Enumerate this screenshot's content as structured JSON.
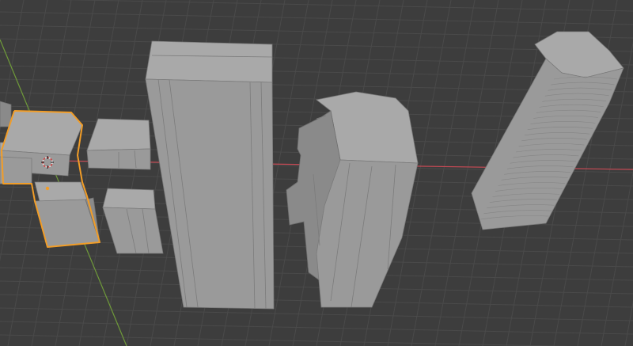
{
  "viewport": {
    "name": "3D Viewport",
    "background_color": "#3d3d3d",
    "grid_color": "#4a4a4a",
    "x_axis_color": "#c84a55",
    "y_axis_color": "#6f9a3a",
    "selection_outline_color": "#f29d27",
    "mesh_face_color": "#9a9a9a",
    "mesh_top_color": "#a9a9a9",
    "mesh_dark_color": "#8a8a8a"
  },
  "scene": {
    "objects": [
      {
        "name": "building-partial-left",
        "selected": false
      },
      {
        "name": "building-l-shaped",
        "selected": true
      },
      {
        "name": "building-small-twin",
        "selected": false
      },
      {
        "name": "building-tall-tower",
        "selected": false
      },
      {
        "name": "building-stepped-tower",
        "selected": false
      },
      {
        "name": "building-curved-tower",
        "selected": false
      }
    ],
    "cursor_icon": "3d-cursor-icon",
    "origin_icon": "object-origin-icon"
  }
}
